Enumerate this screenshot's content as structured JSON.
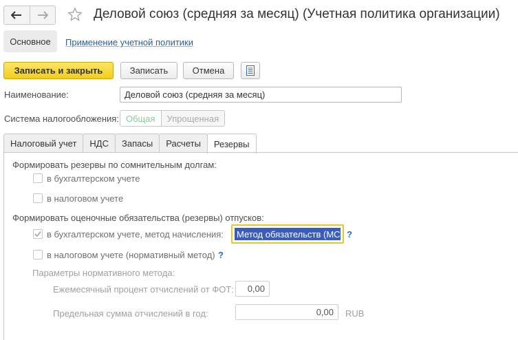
{
  "window": {
    "title": "Деловой союз (средняя за месяц) (Учетная политика организации)",
    "icons": {
      "back": "arrow-left-icon",
      "forward": "arrow-right-icon",
      "favorite": "star-icon"
    }
  },
  "section_tabs": [
    {
      "label": "Основное",
      "active": true
    },
    {
      "label": "Применение учетной политики",
      "active": false
    }
  ],
  "toolbar": {
    "save_close_label": "Записать и закрыть",
    "save_label": "Записать",
    "cancel_label": "Отмена",
    "report_icon": "document-icon"
  },
  "form": {
    "name_label": "Наименование:",
    "name_value": "Деловой союз (средняя за месяц)",
    "tax_system_label": "Система налогообложения:",
    "tax_system_options": [
      "Общая",
      "Упрощенная"
    ],
    "tax_system_selected": "Общая"
  },
  "tabs": [
    {
      "label": "Налоговый учет",
      "active": false
    },
    {
      "label": "НДС",
      "active": false
    },
    {
      "label": "Запасы",
      "active": false
    },
    {
      "label": "Расчеты",
      "active": false
    },
    {
      "label": "Резервы",
      "active": true
    }
  ],
  "reserves": {
    "doubtful_heading": "Формировать резервы по сомнительным долгам:",
    "doubtful_accounting": {
      "label": "в бухгалтерском учете",
      "checked": false
    },
    "doubtful_tax": {
      "label": "в налоговом учете",
      "checked": false
    },
    "vacation_heading": "Формировать оценочные обязательства (резервы) отпусков:",
    "vacation_accounting": {
      "label": "в бухгалтерском учете, метод начисления:",
      "checked": true
    },
    "method_value": "Метод обязательств (МСФ",
    "vacation_tax": {
      "label": "в налоговом учете (нормативный метод)",
      "checked": false
    },
    "help_mark": "?",
    "normative_heading": "Параметры нормативного метода:",
    "monthly_percent_label": "Ежемесячный процент отчислений от ФОТ:",
    "monthly_percent_value": "0,00",
    "annual_limit_label": "Предельная сумма отчислений в год:",
    "annual_limit_value": "0,00",
    "currency": "RUB"
  },
  "colors": {
    "primary_button": "#f2cd1c",
    "link": "#2a5e9e",
    "selection": "#3a5cc0",
    "focus_border": "#e6c72a",
    "help": "#2a6ebb"
  }
}
